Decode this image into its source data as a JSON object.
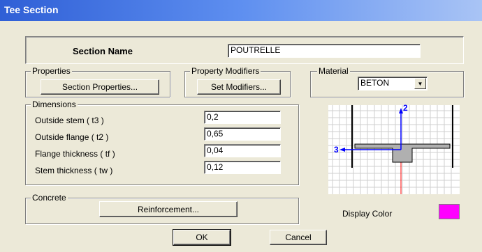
{
  "window": {
    "title": "Tee Section"
  },
  "section_name": {
    "label": "Section Name",
    "value": "POUTRELLE"
  },
  "properties": {
    "group_label": "Properties",
    "button_label": "Section Properties..."
  },
  "property_modifiers": {
    "group_label": "Property Modifiers",
    "button_label": "Set Modifiers..."
  },
  "material": {
    "group_label": "Material",
    "selected": "BETON"
  },
  "dimensions": {
    "group_label": "Dimensions",
    "fields": [
      {
        "label": "Outside stem  ( t3 )",
        "value": "0,2"
      },
      {
        "label": "Outside flange  ( t2 )",
        "value": "0,65"
      },
      {
        "label": "Flange thickness  ( tf )",
        "value": "0,04"
      },
      {
        "label": "Stem thickness  ( tw )",
        "value": "0,12"
      }
    ]
  },
  "preview": {
    "axis_vertical": "2",
    "axis_horizontal": "3"
  },
  "concrete": {
    "group_label": "Concrete",
    "button_label": "Reinforcement..."
  },
  "display_color": {
    "label": "Display Color",
    "color": "#FF00FF"
  },
  "buttons": {
    "ok": "OK",
    "cancel": "Cancel"
  }
}
